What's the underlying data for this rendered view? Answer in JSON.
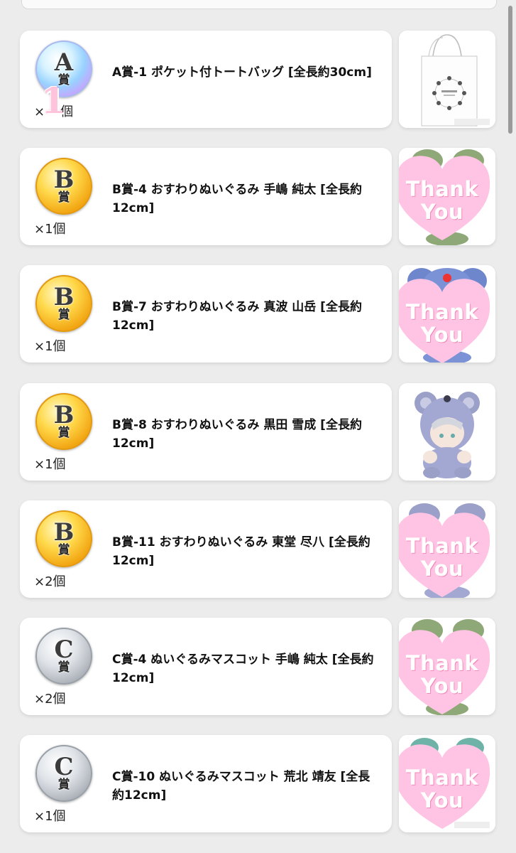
{
  "items": [
    {
      "grade": "A",
      "grade_kanji": "賞",
      "tier": "rainbow",
      "name": "A賞-1 ポケット付トートバッグ [全長約30cm]",
      "qty_prefix": "×",
      "qty_suffix": "個",
      "overlay_number": "1",
      "image": "tote-bag"
    },
    {
      "grade": "B",
      "grade_kanji": "賞",
      "tier": "gold",
      "name": "B賞-4 おすわりぬいぐるみ 手嶋 純太 [全長約12cm]",
      "qty": "×1個",
      "image": "thank-you-sticker",
      "sticker_line1": "Thank",
      "sticker_line2": "You",
      "bg": "green-plush"
    },
    {
      "grade": "B",
      "grade_kanji": "賞",
      "tier": "gold",
      "name": "B賞-7 おすわりぬいぐるみ 真波 山岳 [全長約12cm]",
      "qty": "×1個",
      "image": "thank-you-sticker",
      "sticker_line1": "Thank",
      "sticker_line2": "You",
      "bg": "blue-plush"
    },
    {
      "grade": "B",
      "grade_kanji": "賞",
      "tier": "gold",
      "name": "B賞-8 おすわりぬいぐるみ 黒田 雪成 [全長約12cm]",
      "qty": "×1個",
      "image": "bear-plush"
    },
    {
      "grade": "B",
      "grade_kanji": "賞",
      "tier": "gold",
      "name": "B賞-11 おすわりぬいぐるみ 東堂 尽八 [全長約12cm]",
      "qty": "×2個",
      "image": "thank-you-sticker",
      "sticker_line1": "Thank",
      "sticker_line2": "You",
      "bg": "lavender-plush"
    },
    {
      "grade": "C",
      "grade_kanji": "賞",
      "tier": "silver",
      "name": "C賞-4 ぬいぐるみマスコット 手嶋 純太 [全長約12cm]",
      "qty": "×2個",
      "image": "thank-you-sticker",
      "sticker_line1": "Thank",
      "sticker_line2": "You",
      "bg": "green-plush"
    },
    {
      "grade": "C",
      "grade_kanji": "賞",
      "tier": "silver",
      "name": "C賞-10 ぬいぐるみマスコット 荒北 靖友 [全長約12cm]",
      "qty": "×1個",
      "image": "thank-you-sticker",
      "sticker_line1": "Thank",
      "sticker_line2": "You",
      "bg": "teal-plush"
    }
  ],
  "colors": {
    "sticker_pink": "#ffc4e4",
    "page_bg": "#ececec"
  }
}
